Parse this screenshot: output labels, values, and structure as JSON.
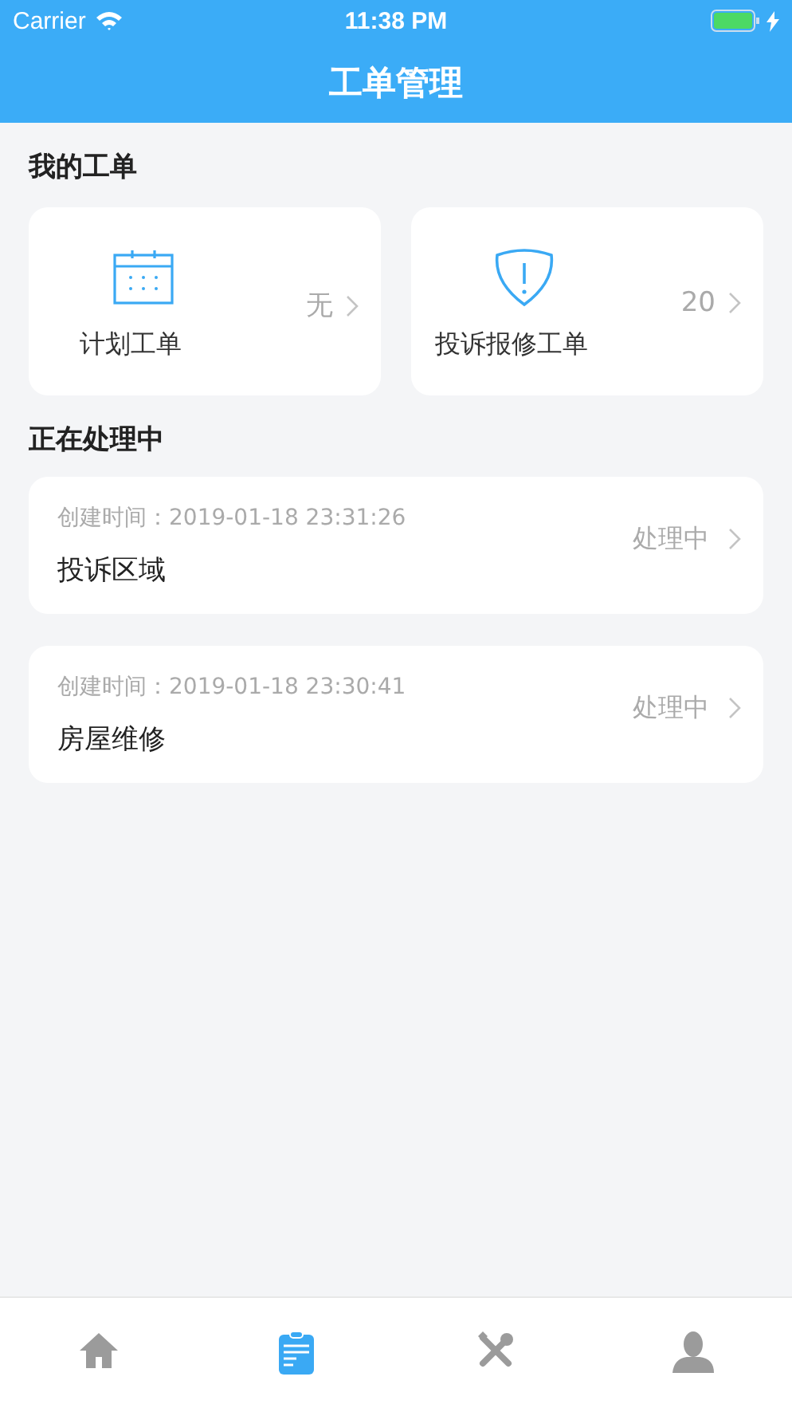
{
  "status_bar": {
    "carrier": "Carrier",
    "time": "11:38 PM"
  },
  "nav_bar": {
    "title": "工单管理"
  },
  "my_orders": {
    "title": "我的工单",
    "cards": [
      {
        "kind": "calendar",
        "label": "计划工单",
        "count": "无"
      },
      {
        "kind": "alert",
        "label": "投诉报修工单",
        "count": "20"
      }
    ]
  },
  "in_progress": {
    "title": "正在处理中",
    "orders": [
      {
        "created": "创建时间：2019-01-18 23:31:26",
        "name": "投诉区域",
        "status": "处理中"
      },
      {
        "created": "创建时间：2019-01-18 23:30:41",
        "name": "房屋维修",
        "status": "处理中"
      }
    ]
  },
  "tab_bar": [
    {
      "kind": "home",
      "selected": false
    },
    {
      "kind": "orders",
      "selected": true
    },
    {
      "kind": "tools",
      "selected": false
    },
    {
      "kind": "profile",
      "selected": false
    }
  ]
}
